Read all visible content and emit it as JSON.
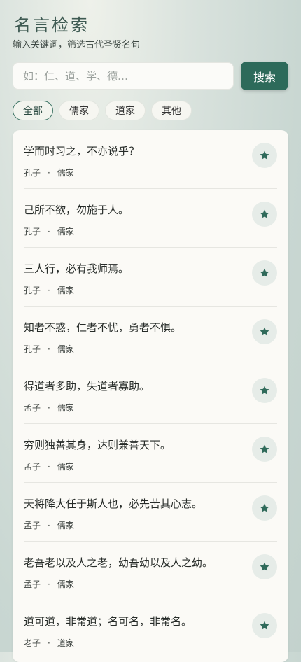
{
  "header": {
    "title": "名言检索",
    "subtitle": "输入关键词，筛选古代圣贤名句"
  },
  "search": {
    "placeholder": "如：仁、道、学、德…",
    "value": "",
    "button_label": "搜索"
  },
  "filters": [
    {
      "label": "全部",
      "active": true
    },
    {
      "label": "儒家",
      "active": false
    },
    {
      "label": "道家",
      "active": false
    },
    {
      "label": "其他",
      "active": false
    }
  ],
  "meta_separator": "·",
  "quotes": [
    {
      "text": "学而时习之，不亦说乎？",
      "author": "孔子",
      "school": "儒家"
    },
    {
      "text": "己所不欲，勿施于人。",
      "author": "孔子",
      "school": "儒家"
    },
    {
      "text": "三人行，必有我师焉。",
      "author": "孔子",
      "school": "儒家"
    },
    {
      "text": "知者不惑，仁者不忧，勇者不惧。",
      "author": "孔子",
      "school": "儒家"
    },
    {
      "text": "得道者多助，失道者寡助。",
      "author": "孟子",
      "school": "儒家"
    },
    {
      "text": "穷则独善其身，达则兼善天下。",
      "author": "孟子",
      "school": "儒家"
    },
    {
      "text": "天将降大任于斯人也，必先苦其心志。",
      "author": "孟子",
      "school": "儒家"
    },
    {
      "text": "老吾老以及人之老，幼吾幼以及人之幼。",
      "author": "孟子",
      "school": "儒家"
    },
    {
      "text": "道可道，非常道；名可名，非常名。",
      "author": "老子",
      "school": "道家"
    }
  ],
  "icons": {
    "favorite": "star-icon"
  },
  "colors": {
    "accent": "#2d6a5a",
    "star": "#2f6a5a",
    "star_bg": "#e6ece8"
  }
}
